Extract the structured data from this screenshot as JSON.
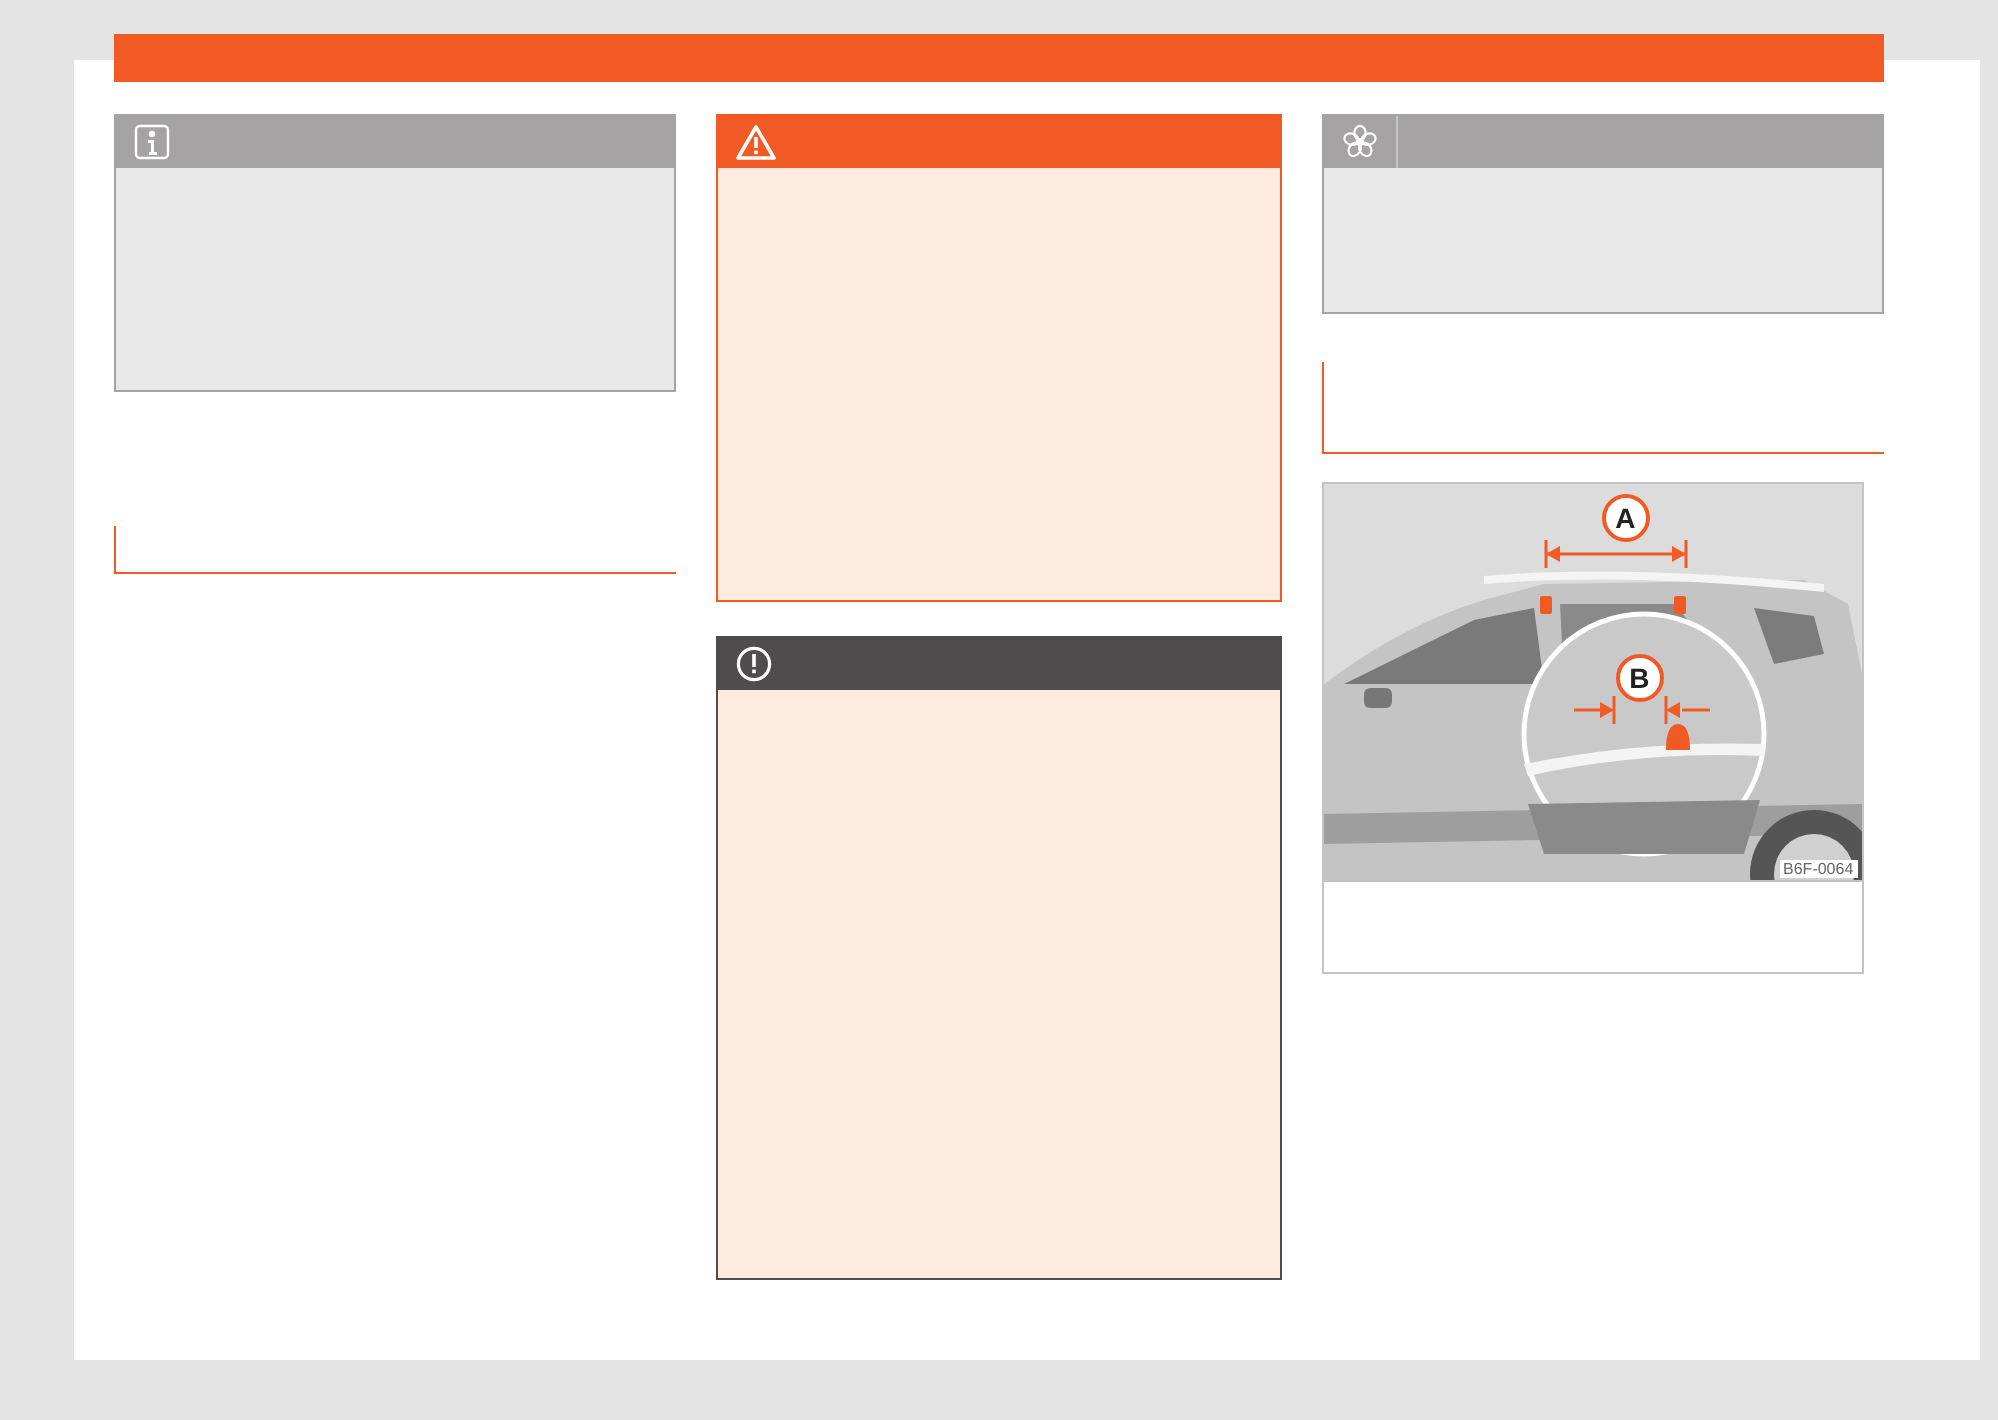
{
  "columns": [
    {
      "blocks": [
        {
          "kind": "info_note"
        },
        {
          "kind": "section_heading"
        }
      ]
    },
    {
      "blocks": [
        {
          "kind": "warning_note"
        },
        {
          "kind": "caution_note"
        }
      ]
    },
    {
      "blocks": [
        {
          "kind": "environment_note"
        },
        {
          "kind": "section_heading"
        },
        {
          "kind": "figure",
          "callouts": [
            "A",
            "B"
          ],
          "figure_code": "B6F-0064"
        }
      ]
    }
  ]
}
